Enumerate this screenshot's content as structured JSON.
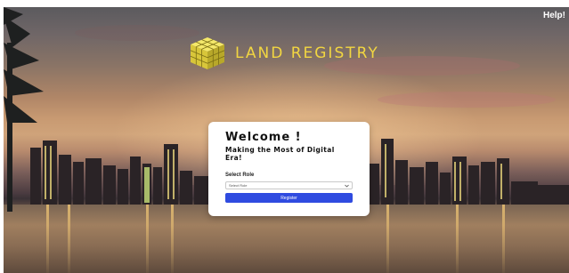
{
  "header": {
    "help_label": "Help!"
  },
  "brand": {
    "name": "LAND REGISTRY",
    "accent": "#f2d641",
    "icon": "cube-logo-icon"
  },
  "card": {
    "title": "Welcome !",
    "subtitle": "Making the Most of Digital Era!",
    "role_label": "Select Role",
    "role_select": {
      "value": "Select Role",
      "icon": "chevron-down-icon"
    },
    "register_label": "Register",
    "button_color": "#2f4be0"
  }
}
